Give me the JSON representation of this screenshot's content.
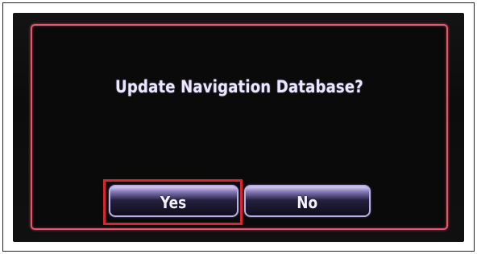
{
  "dialog": {
    "title": "Update Navigation Database?",
    "buttons": {
      "yes_label": "Yes",
      "no_label": "No"
    }
  },
  "colors": {
    "dialog_border": "#e8566e",
    "screen_background": "#0c0c0c",
    "title_text": "#ece7ff",
    "button_border": "#b9aee6",
    "highlight": "#d9262e"
  }
}
